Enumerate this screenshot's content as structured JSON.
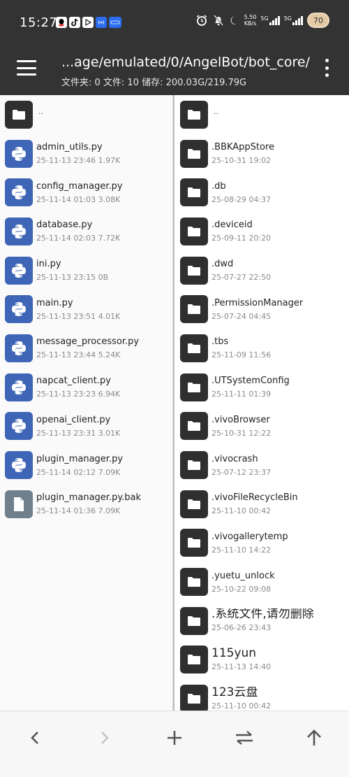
{
  "status": {
    "time": "15:27",
    "net_speed_value": "5.50",
    "net_speed_unit": "KB/s",
    "signal_label_1": "5G",
    "signal_label_2": "5G",
    "battery_level": "70"
  },
  "header": {
    "path": "...age/emulated/0/AngelBot/bot_core/",
    "stats": "文件夹: 0  文件: 10  储存: 200.03G/219.79G"
  },
  "left_pane": {
    "items": [
      {
        "name": "..",
        "info": "",
        "type": "up"
      },
      {
        "name": "admin_utils.py",
        "info": "25-11-13 23:46   1.97K",
        "type": "py"
      },
      {
        "name": "config_manager.py",
        "info": "25-11-14 01:03   3.08K",
        "type": "py"
      },
      {
        "name": "database.py",
        "info": "25-11-14 02:03   7.72K",
        "type": "py"
      },
      {
        "name": "ini.py",
        "info": "25-11-13 23:15   0B",
        "type": "py"
      },
      {
        "name": "main.py",
        "info": "25-11-13 23:51   4.01K",
        "type": "py"
      },
      {
        "name": "message_processor.py",
        "info": "25-11-13 23:44   5.24K",
        "type": "py"
      },
      {
        "name": "napcat_client.py",
        "info": "25-11-13 23:23   6.94K",
        "type": "py"
      },
      {
        "name": "openai_client.py",
        "info": "25-11-13 23:31   3.01K",
        "type": "py"
      },
      {
        "name": "plugin_manager.py",
        "info": "25-11-14 02:12   7.09K",
        "type": "py"
      },
      {
        "name": "plugin_manager.py.bak",
        "info": "25-11-14 01:36   7.09K",
        "type": "doc"
      }
    ]
  },
  "right_pane": {
    "items": [
      {
        "name": "..",
        "info": "",
        "type": "up"
      },
      {
        "name": ".BBKAppStore",
        "info": "25-10-31 19:02"
      },
      {
        "name": ".db",
        "info": "25-08-29 04:37"
      },
      {
        "name": ".deviceid",
        "info": "25-09-11 20:20"
      },
      {
        "name": ".dwd",
        "info": "25-07-27 22:50"
      },
      {
        "name": ".PermissionManager",
        "info": "25-07-24 04:45"
      },
      {
        "name": ".tbs",
        "info": "25-11-09 11:56"
      },
      {
        "name": ".UTSystemConfig",
        "info": "25-11-11 01:39"
      },
      {
        "name": ".vivoBrowser",
        "info": "25-10-31 12:22"
      },
      {
        "name": ".vivocrash",
        "info": "25-07-12 23:37"
      },
      {
        "name": ".vivoFileRecycleBin",
        "info": "25-11-10 00:42"
      },
      {
        "name": ".vivogallerytemp",
        "info": "25-11-10 14:22"
      },
      {
        "name": ".yuetu_unlock",
        "info": "25-10-22 09:08"
      },
      {
        "name": ".系统文件,请勿删除",
        "info": "25-06-26 23:43"
      },
      {
        "name": "115yun",
        "info": "25-11-13 14:40"
      },
      {
        "name": "123云盘",
        "info": "25-11-10 00:42"
      }
    ]
  },
  "bottom_bar": {
    "buttons": [
      "back",
      "forward",
      "add",
      "swap",
      "up"
    ]
  },
  "colors": {
    "dark_bar": "#333333",
    "python_icon_bg": "#3f65b6",
    "folder_icon_bg": "#2f2f2f",
    "doc_icon_bg": "#6f7f8b"
  }
}
